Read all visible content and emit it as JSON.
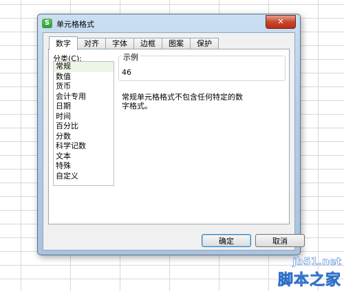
{
  "dialog": {
    "title": "单元格格式",
    "app_icon_glyph": "S",
    "close_glyph": "✕"
  },
  "tabs": [
    {
      "label": "数字",
      "active": true
    },
    {
      "label": "对齐",
      "active": false
    },
    {
      "label": "字体",
      "active": false
    },
    {
      "label": "边框",
      "active": false
    },
    {
      "label": "图案",
      "active": false
    },
    {
      "label": "保护",
      "active": false
    }
  ],
  "category": {
    "label": "分类(C):",
    "items": [
      "常规",
      "数值",
      "货币",
      "会计专用",
      "日期",
      "时间",
      "百分比",
      "分数",
      "科学记数",
      "文本",
      "特殊",
      "自定义"
    ],
    "selected": "常规"
  },
  "example": {
    "legend": "示例",
    "value": "46"
  },
  "description": "常规单元格格式不包含任何特定的数字格式。",
  "buttons": {
    "ok": "确定",
    "cancel": "取消"
  },
  "watermark": {
    "site": "jb51.net",
    "name": "脚本之家"
  },
  "colors": {
    "title_bar": "#b5cde6",
    "close_button": "#c9462c",
    "selected_item": "#ecf5e6"
  }
}
